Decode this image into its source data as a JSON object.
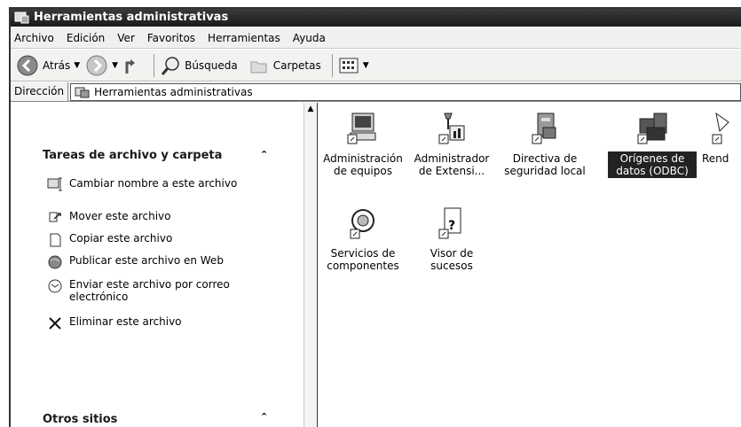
{
  "window": {
    "title": "Herramientas administrativas"
  },
  "menu": [
    "Archivo",
    "Edición",
    "Ver",
    "Favoritos",
    "Herramientas",
    "Ayuda"
  ],
  "toolbar": {
    "back": "Atrás",
    "search": "Búsqueda",
    "folders": "Carpetas"
  },
  "address": {
    "label": "Dirección",
    "value": "Herramientas administrativas"
  },
  "tasks": {
    "title": "Tareas de archivo y carpeta",
    "items": [
      {
        "label": "Cambiar nombre a este archivo",
        "icon": "rename-icon"
      },
      {
        "label": "Mover este archivo",
        "icon": "move-icon"
      },
      {
        "label": "Copiar este archivo",
        "icon": "copy-icon"
      },
      {
        "label": "Publicar este archivo en Web",
        "icon": "publish-web-icon"
      },
      {
        "label": "Enviar este archivo por correo electrónico",
        "icon": "email-icon"
      },
      {
        "label": "Eliminar este archivo",
        "icon": "delete-icon"
      }
    ]
  },
  "other_places": {
    "title": "Otros sitios"
  },
  "files": [
    {
      "label": "Administración de equipos",
      "icon": "computer-management-icon",
      "selected": false
    },
    {
      "label": "Administrador de Extensi...",
      "icon": "extension-admin-icon",
      "selected": false
    },
    {
      "label": "Directiva de seguridad local",
      "icon": "local-security-policy-icon",
      "selected": false
    },
    {
      "label": "Orígenes de datos (ODBC)",
      "icon": "odbc-icon",
      "selected": true
    },
    {
      "label": "Rend",
      "icon": "performance-icon",
      "selected": false
    },
    {
      "label": "Servicios de componentes",
      "icon": "component-services-icon",
      "selected": false
    },
    {
      "label": "Visor de sucesos",
      "icon": "event-viewer-icon",
      "selected": false
    }
  ]
}
